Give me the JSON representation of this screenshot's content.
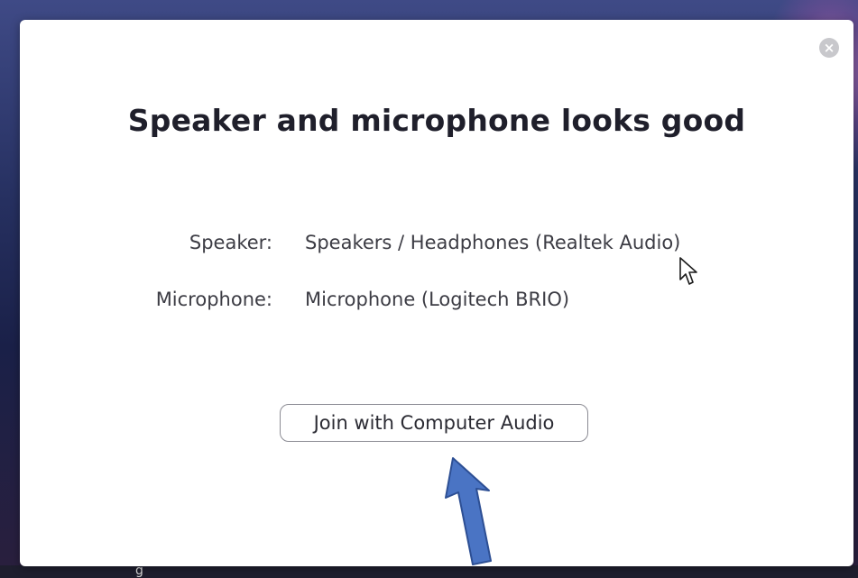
{
  "dialog": {
    "title": "Speaker and microphone looks good",
    "close_icon": "close-icon",
    "speaker": {
      "label": "Speaker:",
      "value": "Speakers / Headphones (Realtek Audio)"
    },
    "microphone": {
      "label": "Microphone:",
      "value": "Microphone (Logitech BRIO)"
    },
    "join_button_label": "Join with Computer Audio"
  },
  "background": {
    "partial_text": "g"
  },
  "colors": {
    "annotation_arrow_fill": "#4a74c4",
    "annotation_arrow_stroke": "#2d4f94",
    "close_button": "#c8c8cc",
    "title_text": "#1f1f2b"
  }
}
